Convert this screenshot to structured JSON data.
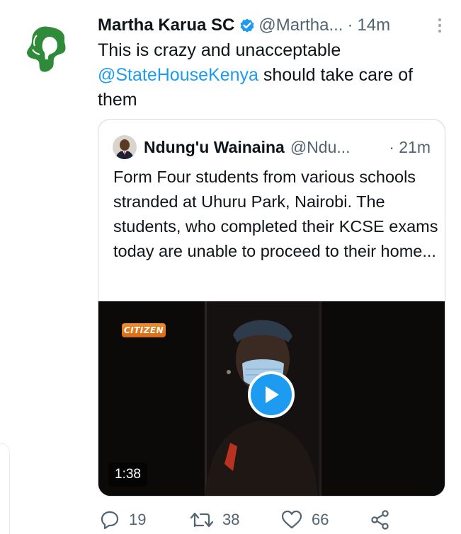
{
  "tweet": {
    "author_name": "Martha Karua SC",
    "author_handle": "@Martha...",
    "time_separator": "·",
    "time": "14m",
    "text_part1": "This is crazy and unacceptable ",
    "mention": "@StateHouseKenya",
    "text_part2": " should take care of them"
  },
  "quoted_tweet": {
    "author_name": "Ndung'u Wainaina",
    "author_handle": "@Ndu...",
    "time": "· 21m",
    "text": "Form Four students from various schools stranded at Uhuru Park, Nairobi. The students, who completed their KCSE exams today are unable to proceed to their home...",
    "video": {
      "duration": "1:38",
      "logo_text": "CITIZEN"
    }
  },
  "actions": {
    "replies": "19",
    "retweets": "38",
    "likes": "66"
  },
  "colors": {
    "accent": "#1d9bf0",
    "secondary_text": "#536471",
    "border": "#cfd9de",
    "avatar_green": "#2f8a3a"
  },
  "icons": {
    "reply": "reply-icon",
    "retweet": "retweet-icon",
    "like": "heart-icon",
    "share": "share-icon",
    "more": "more-icon",
    "verified": "verified-badge-icon",
    "play": "play-icon"
  }
}
